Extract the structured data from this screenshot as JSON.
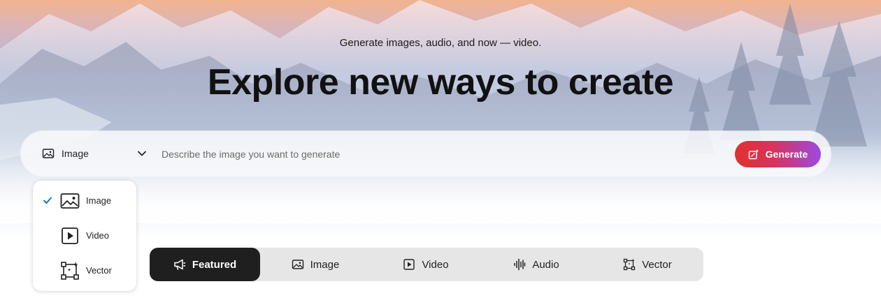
{
  "hero": {
    "subtitle": "Generate images, audio, and now — video.",
    "headline": "Explore new ways to create"
  },
  "prompt_bar": {
    "type_selected": "Image",
    "type_icon": "image-icon",
    "placeholder": "Describe the image you want to generate",
    "input_value": "",
    "generate_label": "Generate",
    "generate_icon": "generate-sparkle-icon"
  },
  "type_menu": {
    "items": [
      {
        "label": "Image",
        "icon": "image-icon",
        "selected": true
      },
      {
        "label": "Video",
        "icon": "video-play-icon",
        "selected": false
      },
      {
        "label": "Vector",
        "icon": "vector-icon",
        "selected": false
      }
    ]
  },
  "category_tabs": {
    "items": [
      {
        "label": "Featured",
        "icon": "megaphone-icon",
        "active": true
      },
      {
        "label": "Image",
        "icon": "image-icon",
        "active": false
      },
      {
        "label": "Video",
        "icon": "video-play-icon",
        "active": false
      },
      {
        "label": "Audio",
        "icon": "audio-waveform-icon",
        "active": false
      },
      {
        "label": "Vector",
        "icon": "vector-icon",
        "active": false
      }
    ]
  },
  "colors": {
    "generate_gradient_start": "#e0312f",
    "generate_gradient_end": "#9a4be2",
    "check_blue": "#1473e6",
    "active_tab_bg": "#1f1f1f"
  }
}
